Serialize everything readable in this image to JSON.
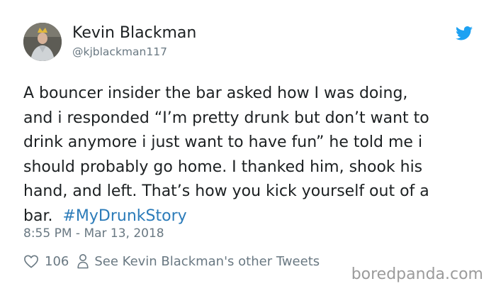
{
  "user": {
    "display_name": "Kevin Blackman",
    "handle": "@kjblackman117"
  },
  "tweet": {
    "lines": [
      "A bouncer insider the bar asked how I was doing,",
      "and i responded “I’m pretty drunk but don’t want to",
      "drink anymore i just want to have fun” he told me i",
      "should probably go home. I thanked him, shook his",
      "hand, and left. That’s how you kick yourself out of a",
      "bar. "
    ],
    "hashtag": "#MyDrunkStory",
    "timestamp": "8:55 PM - Mar 13, 2018"
  },
  "actions": {
    "like_count": "106",
    "other_tweets_label": "See Kevin Blackman's other Tweets"
  },
  "watermark": "boredpanda.com",
  "icons": {
    "brand": "twitter-bird-icon",
    "like": "heart-icon",
    "profile": "person-icon"
  },
  "colors": {
    "text": "#1c2022",
    "muted": "#697882",
    "link": "#2b7bb9",
    "twitter_blue": "#1da1f2",
    "watermark": "#9b9b9b"
  }
}
